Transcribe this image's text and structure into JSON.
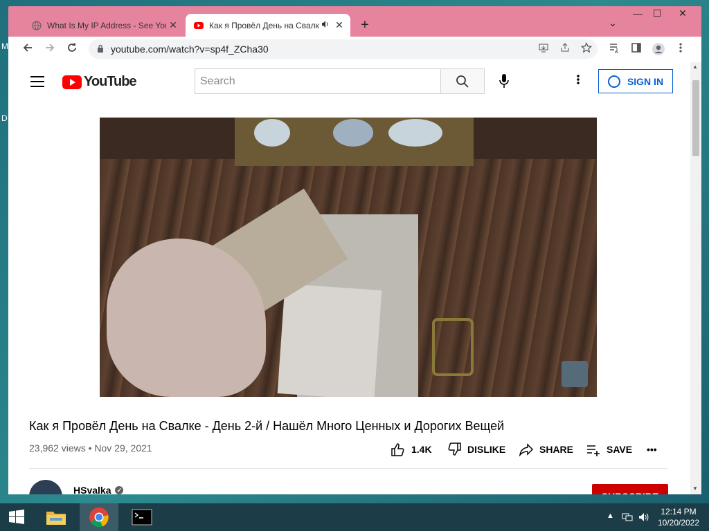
{
  "desktop": {
    "left_letters": [
      "M",
      "D"
    ]
  },
  "browser": {
    "tabs": [
      {
        "title": "What Is My IP Address - See Your",
        "close": "✕"
      },
      {
        "title": "Как я Провёл День на Свалк",
        "close": "✕"
      }
    ],
    "new_tab": "+",
    "window_controls": {
      "tab_search": "⌄",
      "minimize": "—",
      "maximize": "☐",
      "close": "✕"
    },
    "url": "youtube.com/watch?v=sp4f_ZCha30"
  },
  "youtube": {
    "logo_text": "YouTube",
    "search_placeholder": "Search",
    "sign_in_label": "SIGN IN",
    "video": {
      "title": "Как я Провёл День на Свалке - День 2-й / Нашёл Много Ценных и Дорогих Вещей",
      "views": "23,962 views",
      "separator": " • ",
      "date": "Nov 29, 2021"
    },
    "actions": {
      "like_count": "1.4K",
      "dislike_label": "DISLIKE",
      "share_label": "SHARE",
      "save_label": "SAVE",
      "more": "•••"
    },
    "channel": {
      "name": "HSvalka",
      "verified_mark": "✓"
    },
    "subscribe_label": "SUBSCRIBE"
  },
  "taskbar": {
    "clock_time": "12:14 PM",
    "clock_date": "10/20/2022",
    "tray_arrow": "▲"
  }
}
